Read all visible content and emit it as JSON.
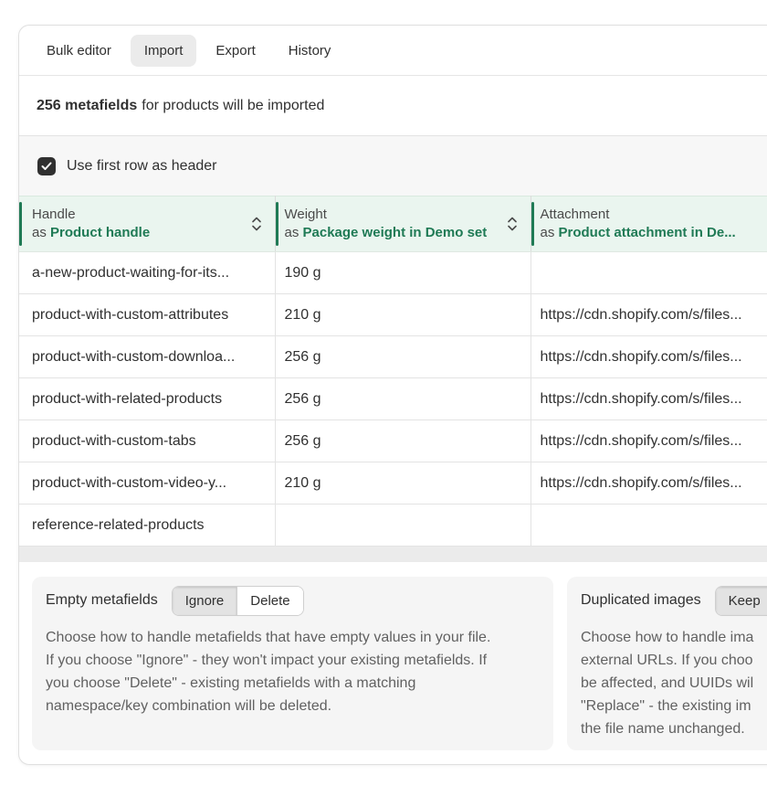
{
  "tabs": [
    {
      "label": "Bulk editor"
    },
    {
      "label": "Import"
    },
    {
      "label": "Export"
    },
    {
      "label": "History"
    }
  ],
  "summary": {
    "count": "256 metafields",
    "text": "for products will be imported"
  },
  "header_option": {
    "label": "Use first row as header",
    "checked": true
  },
  "table": {
    "as_prefix": "as",
    "columns": [
      {
        "name": "Handle",
        "mapping": "Product handle"
      },
      {
        "name": "Weight",
        "mapping": "Package weight in Demo set"
      },
      {
        "name": "Attachment",
        "mapping": "Product attachment in De..."
      }
    ],
    "rows": [
      [
        "a-new-product-waiting-for-its...",
        "190 g",
        ""
      ],
      [
        "product-with-custom-attributes",
        "210 g",
        "https://cdn.shopify.com/s/files..."
      ],
      [
        "product-with-custom-downloa...",
        "256 g",
        "https://cdn.shopify.com/s/files..."
      ],
      [
        "product-with-related-products",
        "256 g",
        "https://cdn.shopify.com/s/files..."
      ],
      [
        "product-with-custom-tabs",
        "256 g",
        "https://cdn.shopify.com/s/files..."
      ],
      [
        "product-with-custom-video-y...",
        "210 g",
        "https://cdn.shopify.com/s/files..."
      ],
      [
        "reference-related-products",
        "",
        ""
      ]
    ]
  },
  "settings": {
    "empty": {
      "title": "Empty metafields",
      "options": [
        "Ignore",
        "Delete"
      ],
      "selected": "Ignore",
      "description": [
        "Choose how to handle metafields that have empty values in your file.",
        "If you choose \"Ignore\" - they won't impact your existing metafields. If",
        "you choose \"Delete\" - existing metafields with a matching",
        "namespace/key combination will be deleted."
      ]
    },
    "duplicated": {
      "title": "Duplicated images",
      "options": [
        "Keep"
      ],
      "selected": "Keep",
      "description": [
        "Choose how to handle ima",
        "external URLs. If you choo",
        "be affected, and UUIDs wil",
        "\"Replace\" - the existing im",
        "the file name unchanged."
      ]
    }
  },
  "colors": {
    "accent": "#1f7a55",
    "header_bg": "#eaf5ef",
    "panel_bg": "#f5f5f5"
  }
}
